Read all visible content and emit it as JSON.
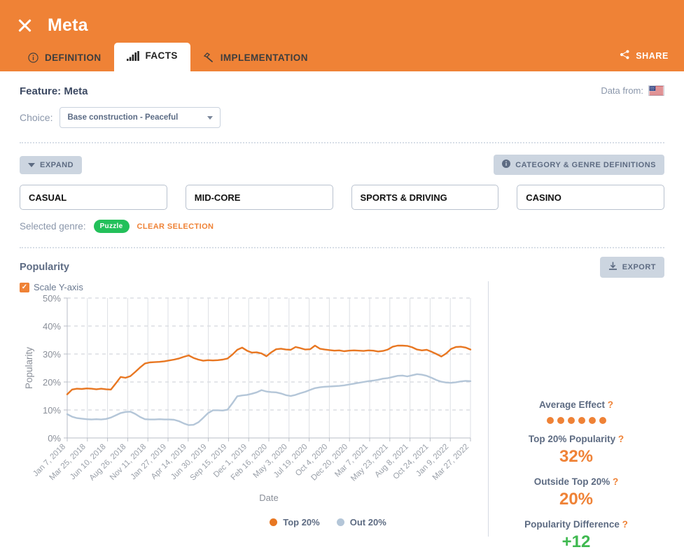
{
  "header": {
    "title": "Meta",
    "close_icon": "close-icon",
    "share_label": "SHARE",
    "share_icon": "share-icon",
    "tabs": [
      {
        "label": "DEFINITION",
        "icon": "info-circle-icon",
        "active": false
      },
      {
        "label": "FACTS",
        "icon": "bar-chart-icon",
        "active": true
      },
      {
        "label": "IMPLEMENTATION",
        "icon": "hammer-icon",
        "active": false
      }
    ]
  },
  "feature": {
    "title": "Feature: Meta",
    "data_from_label": "Data from:",
    "data_from_flag": "us-flag-icon",
    "choice_label": "Choice:",
    "choice_value": "Base construction - Peaceful"
  },
  "controls": {
    "expand_label": "EXPAND",
    "expand_icon": "chevron-down-icon",
    "definitions_label": "CATEGORY & GENRE DEFINITIONS",
    "definitions_icon": "info-icon"
  },
  "categories": [
    {
      "label": "CASUAL"
    },
    {
      "label": "MID-CORE"
    },
    {
      "label": "SPORTS & DRIVING"
    },
    {
      "label": "CASINO"
    }
  ],
  "genre": {
    "label": "Selected genre:",
    "chip": "Puzzle",
    "clear_label": "CLEAR SELECTION"
  },
  "popularity": {
    "section_title": "Popularity",
    "export_label": "EXPORT",
    "export_icon": "download-icon",
    "scale_y_label": "Scale Y-axis",
    "scale_y_checked": true
  },
  "stats": {
    "average_effect_label": "Average Effect",
    "average_effect_dots": 6,
    "top20_label": "Top 20% Popularity",
    "top20_value": "32%",
    "outside20_label": "Outside Top 20%",
    "outside20_value": "20%",
    "difference_label": "Popularity Difference",
    "difference_value": "+12",
    "help_glyph": "?"
  },
  "colors": {
    "brand_orange": "#ef8236",
    "top20_line": "#e87722",
    "out20_line": "#b4c6d8",
    "green": "#3fb950",
    "chip_green": "#23c05a"
  },
  "chart_data": {
    "type": "line",
    "title": "Popularity",
    "xlabel": "Date",
    "ylabel": "Popularity",
    "ylim": [
      0,
      50
    ],
    "yticks": [
      "0%",
      "10%",
      "20%",
      "30%",
      "40%",
      "50%"
    ],
    "grid": true,
    "legend_position": "bottom",
    "categories": [
      "Jan 7, 2018",
      "Mar 25, 2018",
      "Jun 10, 2018",
      "Aug 26, 2018",
      "Nov 11, 2018",
      "Jan 27, 2019",
      "Apr 14, 2019",
      "Jun 30, 2019",
      "Sep 15, 2019",
      "Dec 1, 2019",
      "Feb 16, 2020",
      "May 3, 2020",
      "Jul 19, 2020",
      "Oct 4, 2020",
      "Dec 20, 2020",
      "Mar 7, 2021",
      "May 23, 2021",
      "Aug 8, 2021",
      "Oct 24, 2021",
      "Jan 9, 2022",
      "Mar 27, 2022"
    ],
    "series": [
      {
        "name": "Top 20%",
        "color": "#e87722",
        "values": [
          15.6,
          17.3,
          17.6,
          17.5,
          17.7,
          17.6,
          17.4,
          17.6,
          17.4,
          17.3,
          19.5,
          21.8,
          21.5,
          22.1,
          23.6,
          25.2,
          26.6,
          27.0,
          27.1,
          27.2,
          27.4,
          27.7,
          28.0,
          28.4,
          29.0,
          29.5,
          28.6,
          28.0,
          27.6,
          27.8,
          27.7,
          27.8,
          28.0,
          28.4,
          29.8,
          31.5,
          32.3,
          31.2,
          30.5,
          30.6,
          30.2,
          29.2,
          30.6,
          31.7,
          31.9,
          31.6,
          31.5,
          32.5,
          32.1,
          31.6,
          31.7,
          33.0,
          31.9,
          31.6,
          31.4,
          31.2,
          31.3,
          31.0,
          31.2,
          31.3,
          31.2,
          31.1,
          31.3,
          31.2,
          30.9,
          31.1,
          31.6,
          32.6,
          33.0,
          33.0,
          32.9,
          32.4,
          31.6,
          31.3,
          31.5,
          30.8,
          30.0,
          29.1,
          30.2,
          31.8,
          32.5,
          32.6,
          32.3,
          31.6
        ]
      },
      {
        "name": "Out 20%",
        "color": "#b4c6d8",
        "values": [
          8.5,
          7.6,
          7.1,
          6.9,
          6.7,
          6.6,
          6.7,
          6.6,
          6.8,
          7.3,
          8.1,
          8.9,
          9.3,
          9.4,
          8.6,
          7.5,
          6.7,
          6.6,
          6.6,
          6.7,
          6.6,
          6.6,
          6.5,
          6.0,
          5.2,
          4.6,
          4.7,
          5.6,
          7.2,
          8.9,
          9.9,
          9.9,
          9.8,
          10.1,
          12.4,
          14.9,
          15.2,
          15.4,
          15.8,
          16.3,
          17.1,
          16.6,
          16.4,
          16.3,
          15.9,
          15.3,
          15.0,
          15.4,
          16.0,
          16.5,
          17.2,
          17.8,
          18.1,
          18.3,
          18.4,
          18.5,
          18.6,
          18.8,
          19.1,
          19.4,
          19.7,
          20.0,
          20.3,
          20.5,
          20.8,
          21.2,
          21.4,
          21.8,
          22.2,
          22.3,
          22.0,
          22.4,
          22.8,
          22.6,
          22.2,
          21.5,
          20.7,
          20.1,
          19.8,
          19.7,
          19.9,
          20.2,
          20.4,
          20.3
        ]
      }
    ]
  }
}
